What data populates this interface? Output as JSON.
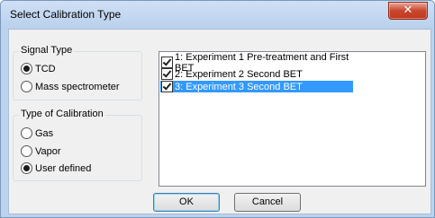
{
  "window": {
    "title": "Select Calibration Type",
    "close_glyph": "✕"
  },
  "signal_type": {
    "legend": "Signal Type",
    "options": [
      {
        "label": "TCD",
        "selected": true
      },
      {
        "label": "Mass spectrometer",
        "selected": false
      }
    ]
  },
  "calibration_type": {
    "legend": "Type of Calibration",
    "options": [
      {
        "label": "Gas",
        "selected": false
      },
      {
        "label": "Vapor",
        "selected": false
      },
      {
        "label": "User defined",
        "selected": true
      }
    ]
  },
  "experiments": [
    {
      "label": "1: Experiment 1 Pre-treatment and First BET",
      "checked": true,
      "selected": false
    },
    {
      "label": "2: Experiment 2 Second BET",
      "checked": true,
      "selected": false
    },
    {
      "label": "3: Experiment 3 Second BET",
      "checked": true,
      "selected": true
    }
  ],
  "buttons": {
    "ok": "OK",
    "cancel": "Cancel"
  }
}
